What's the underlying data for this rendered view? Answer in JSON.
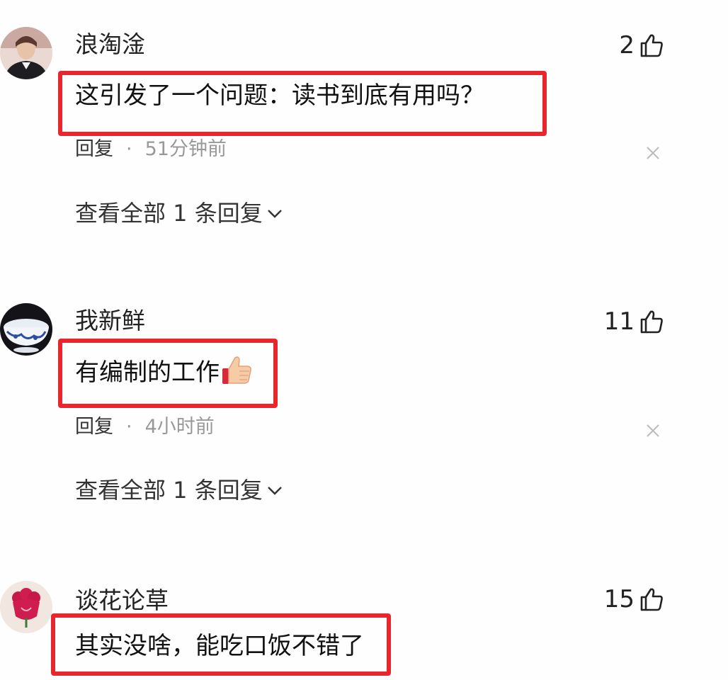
{
  "comments": [
    {
      "username": "浪淘淦",
      "likes": "2",
      "text": "这引发了一个问题：读书到底有用吗？",
      "reply_label": "回复",
      "separator": "·",
      "time": "51分钟前",
      "view_replies": "查看全部 1 条回复",
      "avatar_icon": "person-avatar"
    },
    {
      "username": "我新鲜",
      "likes": "11",
      "text": "有编制的工作",
      "text_emoji": "thumbs-up-emoji",
      "reply_label": "回复",
      "separator": "·",
      "time": "4小时前",
      "view_replies": "查看全部 1 条回复",
      "avatar_icon": "porcelain-bowl-avatar"
    },
    {
      "username": "谈花论草",
      "likes": "15",
      "text": "其实没啥，能吃口饭不错了",
      "avatar_icon": "red-flower-avatar"
    }
  ],
  "colors": {
    "highlight_border": "#e8262e",
    "muted_text": "#999999"
  }
}
